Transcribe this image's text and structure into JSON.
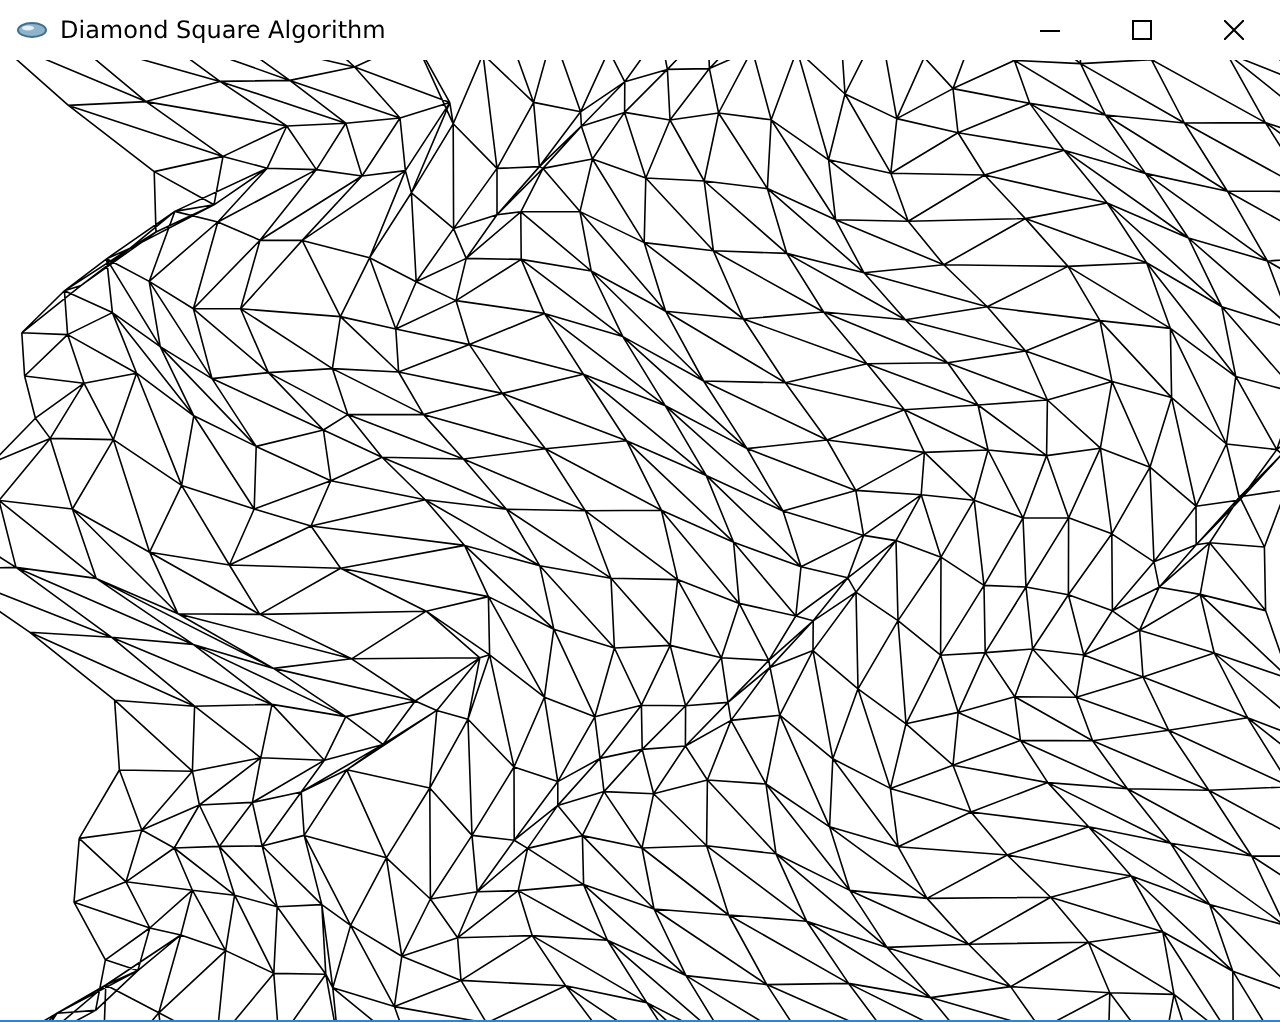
{
  "window": {
    "title": "Diamond Square Algorithm"
  }
}
